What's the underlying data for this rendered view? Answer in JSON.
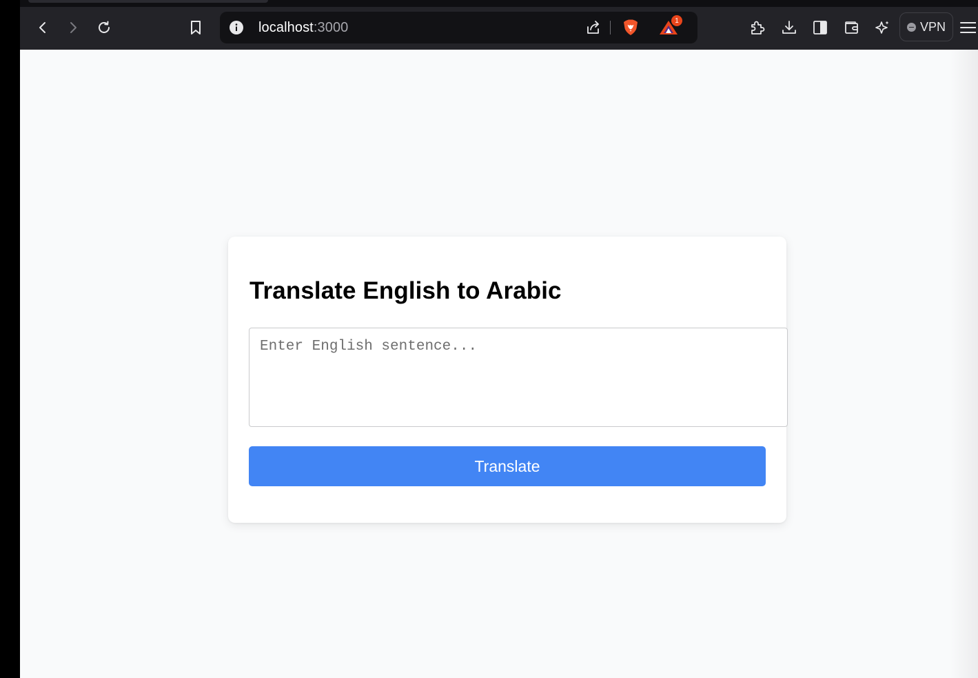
{
  "browser": {
    "address_host": "localhost",
    "address_port": ":3000",
    "rewards_badge_count": "1",
    "vpn_label": "VPN",
    "accent_color": "#e9451b"
  },
  "app": {
    "title": "Translate English to Arabic",
    "input_placeholder": "Enter English sentence...",
    "input_value": "",
    "button_label": "Translate",
    "button_color": "#4285f4"
  }
}
